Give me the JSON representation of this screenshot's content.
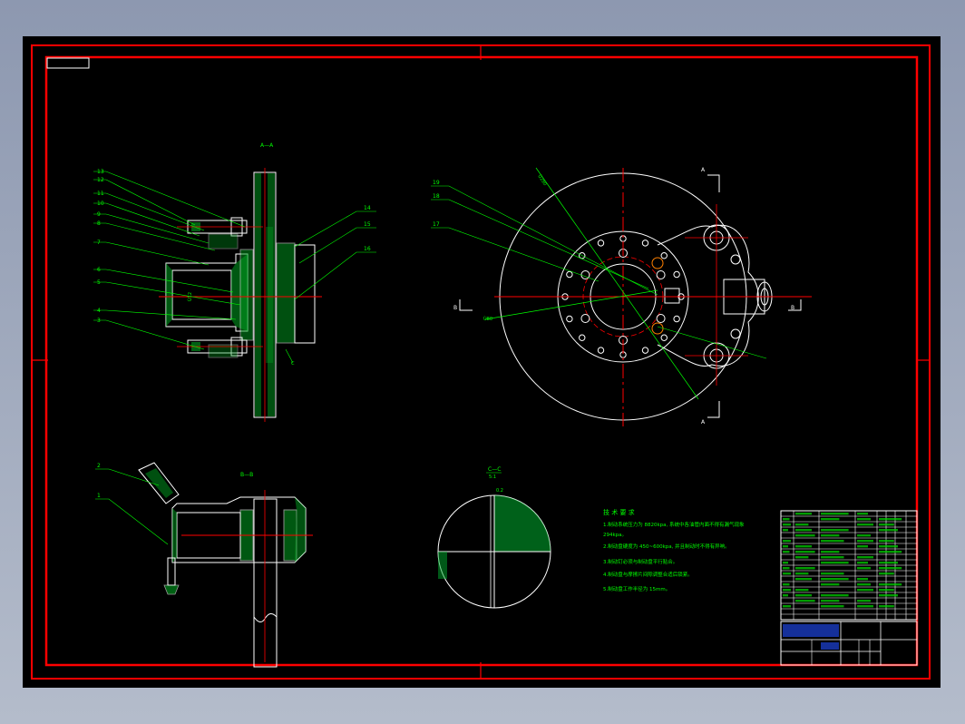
{
  "sections": {
    "aa": "A—A",
    "bb": "B—B",
    "cc": "C—C",
    "cc_scale": "5:1",
    "cut_a": "A",
    "cut_b": "B",
    "cut_c": "C"
  },
  "leaders_left": [
    "13",
    "12",
    "11",
    "10",
    "9",
    "8",
    "7",
    "6",
    "5",
    "4",
    "3"
  ],
  "leaders_right": [
    "14",
    "15",
    "16"
  ],
  "leaders_view": [
    "19",
    "18",
    "17"
  ],
  "leaders_bb": [
    "2",
    "1"
  ],
  "dims": {
    "d1": "Ù280",
    "d2": "Ù80",
    "d3": "Ù12",
    "cc_dim": "0.2"
  },
  "notes": {
    "heading": "技 术 要 求",
    "lines": [
      "1.制动系统压力为 8820kpa, 系统中各油管内面不得有漏气现象",
      "  294kpa。",
      "2.制动盘硬度为 450~600kpa, 并且制动时不得有异响。",
      "3.制动钉必须与制动盘平行贴合。",
      "4.制动盘与摩擦片间隙调整合适后锁紧。",
      "5.制动盘工作半径为 15mm。"
    ]
  }
}
